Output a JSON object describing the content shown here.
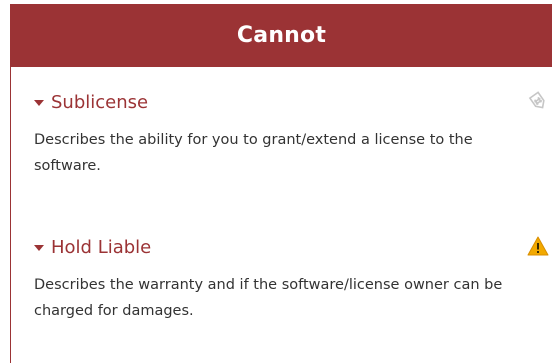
{
  "header": {
    "title": "Cannot"
  },
  "items": [
    {
      "title": "Sublicense",
      "description": "Describes the ability for you to grant/extend a license to the software.",
      "icon": "hashtag-tag-icon",
      "icon_color": "#c8c8c8"
    },
    {
      "title": "Hold Liable",
      "description": "Describes the warranty and if the software/license owner can be charged for damages.",
      "icon": "warning-icon",
      "icon_color": "#f2a900"
    }
  ],
  "colors": {
    "accent": "#9b3335",
    "text": "#333333"
  }
}
